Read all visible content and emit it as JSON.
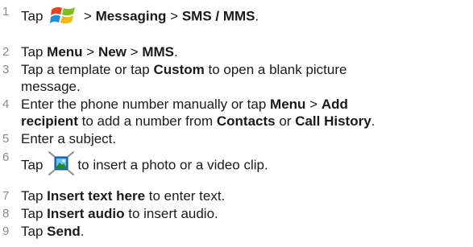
{
  "steps": [
    {
      "num": "1",
      "a": "Tap",
      "b": ">",
      "c": "Messaging",
      "d": ">",
      "e": "SMS / MMS",
      "f": "."
    },
    {
      "num": "2",
      "a": "Tap",
      "b": "Menu",
      "c": ">",
      "d": "New",
      "e": ">",
      "f": "MMS",
      "g": "."
    },
    {
      "num": "3",
      "a": "Tap a template or tap",
      "b": "Custom",
      "c": "to open a blank picture",
      "d": "message."
    },
    {
      "num": "4",
      "a": "Enter the phone number manually or tap",
      "b": "Menu",
      "c": ">",
      "d": "Add",
      "e": "recipient",
      "f": "to add a number from",
      "g": "Contacts",
      "h": "or",
      "i": "Call History",
      "j": "."
    },
    {
      "num": "5",
      "a": "Enter a subject."
    },
    {
      "num": "6",
      "a": "Tap",
      "b": "to insert a photo or a video clip."
    },
    {
      "num": "7",
      "a": "Tap",
      "b": "Insert text here",
      "c": "to enter text."
    },
    {
      "num": "8",
      "a": "Tap",
      "b": "Insert audio",
      "c": "to insert audio."
    },
    {
      "num": "9",
      "a": "Tap",
      "b": "Send",
      "c": "."
    }
  ],
  "icons": {
    "start": "windows-start-icon",
    "insert": "insert-picture-icon"
  },
  "colors": {
    "text": "#1a1a1a",
    "number": "#8a8a8a"
  }
}
